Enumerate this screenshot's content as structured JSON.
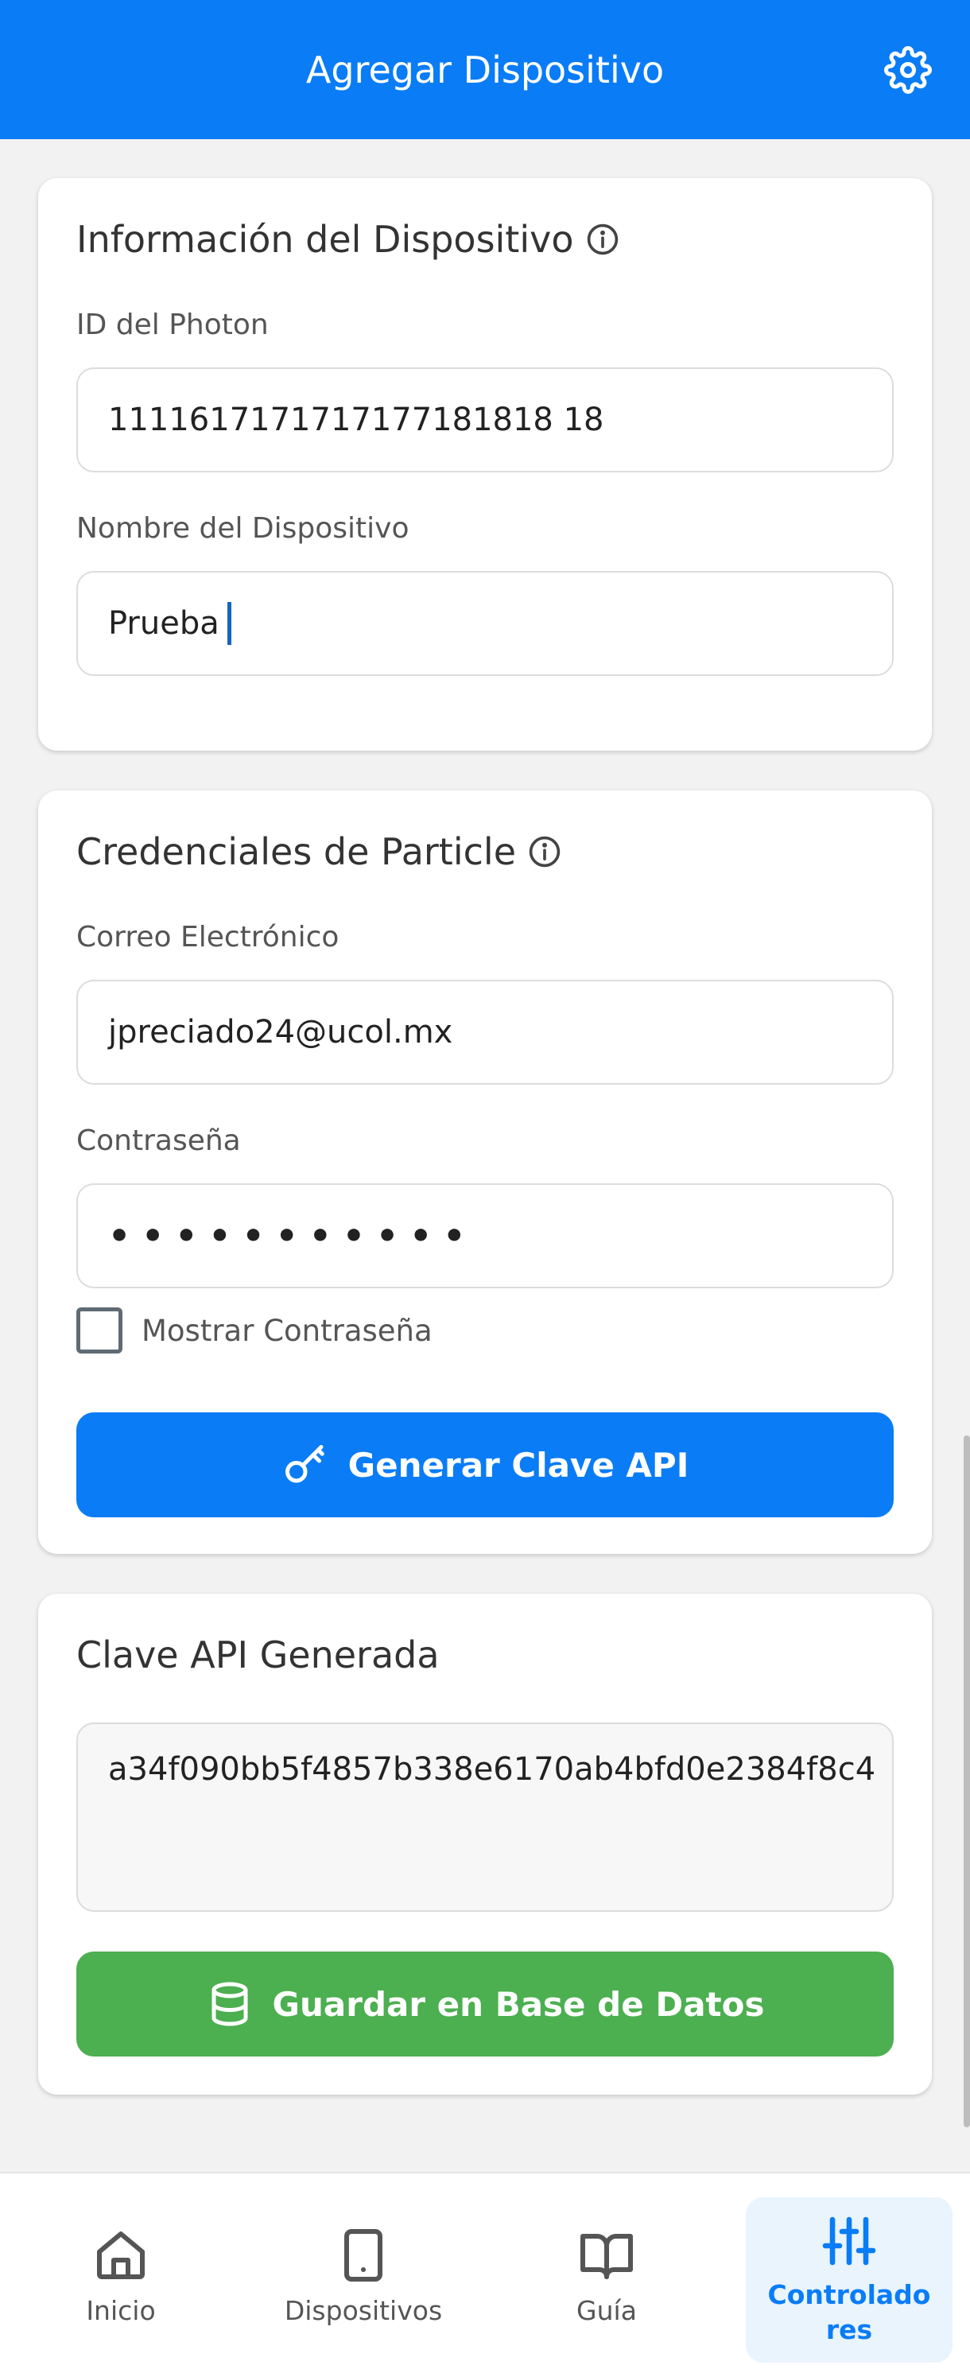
{
  "header": {
    "title": "Agregar Dispositivo",
    "settings_icon": "gear-icon"
  },
  "device_info": {
    "title": "Información del Dispositivo",
    "info_icon": "info-icon",
    "photon_id_label": "ID del Photon",
    "photon_id_value": "1111617171717177181818 18",
    "device_name_label": "Nombre del Dispositivo",
    "device_name_value": "Prueba"
  },
  "credentials": {
    "title": "Credenciales de Particle",
    "info_icon": "info-icon",
    "email_label": "Correo Electrónico",
    "email_value": "jpreciado24@ucol.mx",
    "password_label": "Contraseña",
    "password_masked": "•••••••••••",
    "show_password_label": "Mostrar Contraseña",
    "show_password_checked": false,
    "generate_button_label": "Generar Clave API",
    "generate_button_icon": "key-icon"
  },
  "api_key": {
    "title": "Clave API Generada",
    "value": "a34f090bb5f4857b338e6170ab4bfd0e2384f8c4",
    "save_button_label": "Guardar en Base de Datos",
    "save_button_icon": "database-icon"
  },
  "bottom_nav": {
    "items": [
      {
        "label": "Inicio",
        "icon": "home-icon",
        "active": false
      },
      {
        "label": "Dispositivos",
        "icon": "smartphone-icon",
        "active": false
      },
      {
        "label": "Guía",
        "icon": "book-icon",
        "active": false
      },
      {
        "label": "Controladores",
        "icon": "sliders-icon",
        "active": true
      }
    ]
  },
  "colors": {
    "primary": "#0a7cf6",
    "success": "#4caf50",
    "background": "#f2f2f2"
  }
}
